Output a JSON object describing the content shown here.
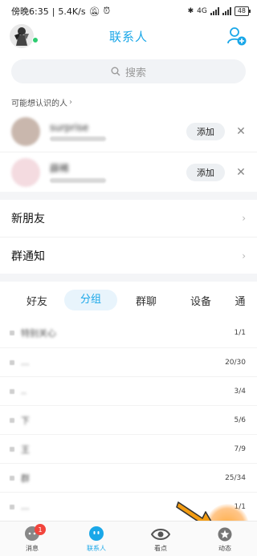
{
  "status": {
    "time": "傍晚6:35",
    "speed": "5.4K/s",
    "battery": "48",
    "network": "4G"
  },
  "header": {
    "title": "联系人"
  },
  "search": {
    "placeholder": "搜索"
  },
  "suggestions": {
    "label": "可能想认识的人",
    "items": [
      {
        "name": "surprise",
        "add_label": "添加"
      },
      {
        "name": "薛稀",
        "add_label": "添加"
      }
    ]
  },
  "menu": {
    "new_friends": "新朋友",
    "group_notice": "群通知"
  },
  "tabs": [
    "好友",
    "分组",
    "群聊",
    "设备",
    "通"
  ],
  "groups": [
    {
      "name": "特别关心",
      "count": "1/1"
    },
    {
      "name": "...",
      "count": "20/30"
    },
    {
      "name": "..",
      "count": "3/4"
    },
    {
      "name": "下",
      "count": "5/6"
    },
    {
      "name": "王",
      "count": "7/9"
    },
    {
      "name": "群",
      "count": "25/34"
    },
    {
      "name": "...",
      "count": "1/1"
    }
  ],
  "nav": {
    "messages": "消息",
    "messages_badge": "1",
    "contacts": "联系人",
    "watch": "看点",
    "moments": "动态"
  },
  "colors": {
    "accent": "#1aa7e8",
    "online": "#2ecc71",
    "badge": "#f2453d"
  }
}
